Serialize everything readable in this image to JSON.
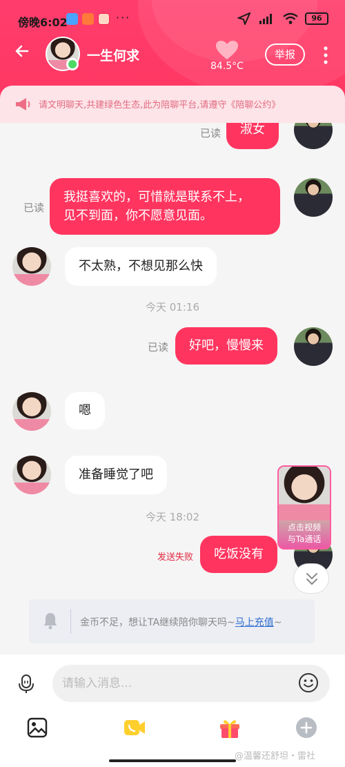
{
  "status_bar": {
    "time": "傍晚6:02",
    "dots": "···",
    "battery": "96"
  },
  "header": {
    "contact_name": "一生何求",
    "temperature": "84.5°C",
    "report_label": "举报"
  },
  "notice": {
    "text": "请文明聊天,共建绿色生态,此为陪聊平台,请遵守《陪聊公约》"
  },
  "messages": [
    {
      "side": "out",
      "text": "淑女",
      "status": "已读"
    },
    {
      "side": "out",
      "text": "我挺喜欢的，可惜就是联系不上，见不到面，你不愿意见面。",
      "line1": "我挺喜欢的，可惜就是联系不上，",
      "line2": "见不到面，你不愿意见面。",
      "status": "已读"
    },
    {
      "side": "in",
      "text": "不太熟，不想见那么快"
    },
    {
      "side": "time",
      "text": "今天 01:16"
    },
    {
      "side": "out",
      "text": "好吧，慢慢来",
      "status": "已读"
    },
    {
      "side": "in",
      "text": "嗯"
    },
    {
      "side": "in",
      "text": "准备睡觉了吧"
    },
    {
      "side": "time",
      "text": "今天 18:02"
    },
    {
      "side": "out",
      "text": "吃饭没有",
      "status": "发送失败"
    }
  ],
  "video_card": {
    "line1": "点击视频",
    "line2": "与Ta通话"
  },
  "coin_banner": {
    "text": "金币不足，想让TA继续陪你聊天吗~",
    "link": "马上充值",
    "tail": "~"
  },
  "input": {
    "placeholder": "请输入消息..."
  },
  "watermark": "@温馨还舒坦・雷社",
  "colors": {
    "accent": "#ff355f",
    "notice_bg": "#fde4e8",
    "notice_text": "#e26b82",
    "failed": "#e0263f",
    "link": "#2e6cd1"
  }
}
